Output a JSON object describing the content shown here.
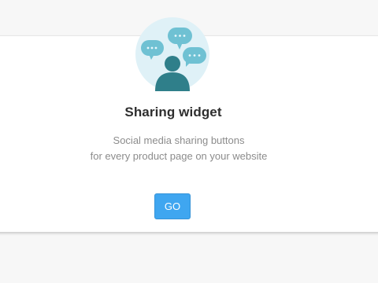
{
  "widget": {
    "title": "Sharing widget",
    "description_line1": "Social media sharing buttons",
    "description_line2": "for every product page on your website",
    "button_label": "GO",
    "icon": "people-chat-bubbles-icon"
  },
  "colors": {
    "accent": "#3fa6f0",
    "icon_circle": "#dff1f7",
    "icon_figure": "#2f7f8a",
    "icon_bubble": "#6fc1d3"
  }
}
